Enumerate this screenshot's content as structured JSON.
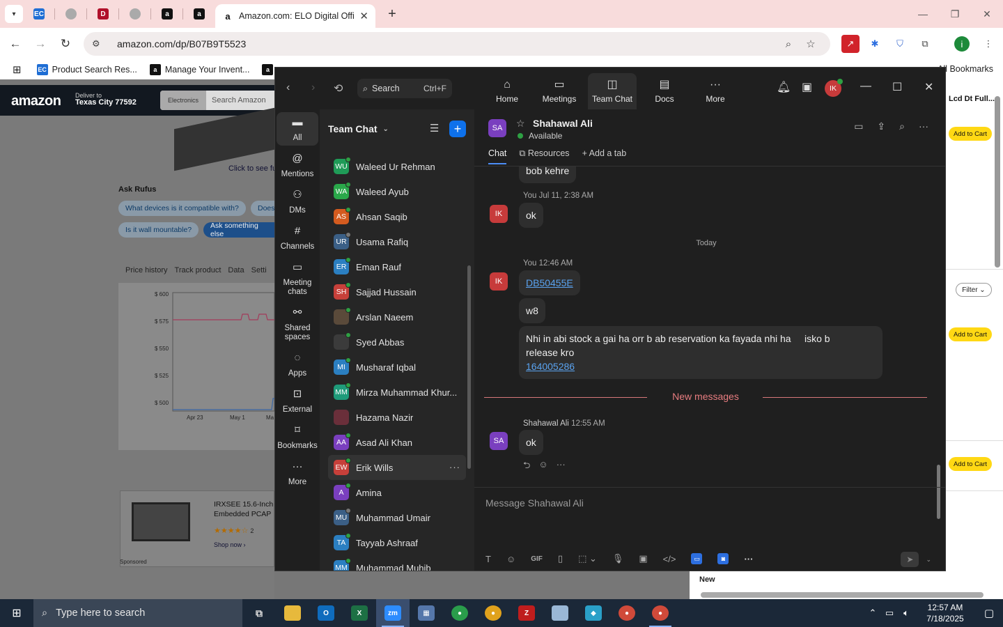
{
  "browser": {
    "active_tab_title": "Amazon.com: ELO Digital Office",
    "url": "amazon.com/dp/B07B9T5523",
    "bookmarks": [
      "Product Search Res...",
      "Manage Your Invent..."
    ],
    "all_bookmarks_label": "All Bookmarks"
  },
  "amazon": {
    "logo": "amazon",
    "deliver_to_label": "Deliver to",
    "deliver_to_city": "Texas City 77592",
    "search_category": "Electronics",
    "search_placeholder": "Search Amazon",
    "click_to_see": "Click to see fu",
    "rufus_title": "Ask Rufus",
    "rufus_q1": "What devices is it compatible with?",
    "rufus_q2": "Does",
    "rufus_q3": "Is it wall mountable?",
    "rufus_q4": "Ask something else",
    "price_tabs": [
      "Price history",
      "Track product",
      "Data",
      "Setti"
    ],
    "chart_yticks": [
      "$ 600",
      "$ 575",
      "$ 550",
      "$ 525",
      "$ 500"
    ],
    "chart_xticks": [
      "Apr 23",
      "May 1",
      "Ma"
    ],
    "sponsored_title_1": "IRXSEE 15.6-Inch",
    "sponsored_title_2": "Embedded PCAP",
    "sponsored_rating_count": "2",
    "shop_now": "Shop now ›",
    "sponsored_label": "Sponsored",
    "right_title": "Lcd Dt Full...",
    "add_to_cart": "Add to Cart",
    "filter": "Filter",
    "new_label": "New"
  },
  "zoom": {
    "search_label": "Search",
    "search_shortcut": "Ctrl+F",
    "nav": [
      {
        "label": "Home",
        "icon": "home-icon"
      },
      {
        "label": "Meetings",
        "icon": "video-icon"
      },
      {
        "label": "Team Chat",
        "icon": "chat-icon"
      },
      {
        "label": "Docs",
        "icon": "docs-icon"
      },
      {
        "label": "More",
        "icon": "more-icon"
      }
    ],
    "me_initials": "IK",
    "rail": [
      {
        "label": "All",
        "icon": "all-chat-icon"
      },
      {
        "label": "Mentions",
        "icon": "at-icon"
      },
      {
        "label": "DMs",
        "icon": "dms-icon"
      },
      {
        "label": "Channels",
        "icon": "hash-icon"
      },
      {
        "label": "Meeting chats",
        "icon": "calendar-icon"
      },
      {
        "label": "Shared spaces",
        "icon": "shared-spaces-icon"
      },
      {
        "label": "Apps",
        "icon": "apps-icon"
      },
      {
        "label": "External",
        "icon": "external-icon"
      },
      {
        "label": "Bookmarks",
        "icon": "bookmark-icon"
      },
      {
        "label": "More",
        "icon": "more-icon"
      }
    ],
    "list_title": "Team Chat",
    "contacts": [
      {
        "initials": "WU",
        "name": "Waleed Ur Rehman",
        "color": "#1f9b57",
        "presence": "#2ea043"
      },
      {
        "initials": "WA",
        "name": "Waleed Ayub",
        "color": "#2aa84a",
        "presence": "#2ea043"
      },
      {
        "initials": "AS",
        "name": "Ahsan Saqib",
        "color": "#d45b1f",
        "presence": "#2ea043"
      },
      {
        "initials": "UR",
        "name": "Usama Rafiq",
        "color": "#3b5f86",
        "presence": "#777777"
      },
      {
        "initials": "ER",
        "name": "Eman Rauf",
        "color": "#2b7fc1",
        "presence": "#2ea043"
      },
      {
        "initials": "SH",
        "name": "Sajjad Hussain",
        "color": "#c7403a",
        "presence": "#2ea043"
      },
      {
        "initials": "",
        "name": "Arslan Naeem",
        "color": "#5a4a3a",
        "presence": "#2ea043"
      },
      {
        "initials": "",
        "name": "Syed Abbas",
        "color": "#3b3b3b",
        "presence": "#2ea043"
      },
      {
        "initials": "MI",
        "name": "Musharaf Iqbal",
        "color": "#2b7fc1",
        "presence": "#2ea043"
      },
      {
        "initials": "MM",
        "name": "Mirza Muhammad Khur...",
        "color": "#1f9b7a",
        "presence": "#2ea043"
      },
      {
        "initials": "",
        "name": "Hazama Nazir",
        "color": "#6a2f3a",
        "presence": ""
      },
      {
        "initials": "AA",
        "name": "Asad Ali Khan",
        "color": "#7a3fbf",
        "presence": "#2ea043"
      },
      {
        "initials": "EW",
        "name": "Erik Wills",
        "color": "#c7403a",
        "presence": "#2ea043"
      },
      {
        "initials": "A",
        "name": "Amina",
        "color": "#7a3fbf",
        "presence": "#2ea043"
      },
      {
        "initials": "MU",
        "name": "Muhammad Umair",
        "color": "#3b5f86",
        "presence": "#777777"
      },
      {
        "initials": "TA",
        "name": "Tayyab Ashraaf",
        "color": "#2b7fc1",
        "presence": "#2ea043"
      },
      {
        "initials": "MM",
        "name": "Muhammad Muhib",
        "color": "#2b7fc1",
        "presence": "#2ea043"
      }
    ],
    "peer": {
      "initials": "SA",
      "name": "Shahawal Ali",
      "status": "Available"
    },
    "chat_tabs": [
      "Chat",
      "Resources",
      "Add a tab"
    ],
    "messages": {
      "prev_text": "bob kehre",
      "m1_meta": "You Jul 11, 2:38 AM",
      "m1_text": "ok",
      "today": "Today",
      "m2_meta": "You 12:46 AM",
      "m2_link": "DB50455E",
      "m2_text": "w8",
      "m2_long_1": "Nhi in abi stock a gai ha orr b ab reservation ka fayada nhi ha     isko b",
      "m2_long_2": "release kro",
      "m2_long_link": "164005286",
      "new_messages": "New messages",
      "m3_meta_name": "Shahawal Ali",
      "m3_meta_time": "12:55 AM",
      "m3_text": "ok"
    },
    "composer_placeholder": "Message Shahawal Ali",
    "gif_label": "GIF"
  },
  "taskbar": {
    "search_placeholder": "Type here to search",
    "time": "12:57 AM",
    "date": "7/18/2025"
  }
}
